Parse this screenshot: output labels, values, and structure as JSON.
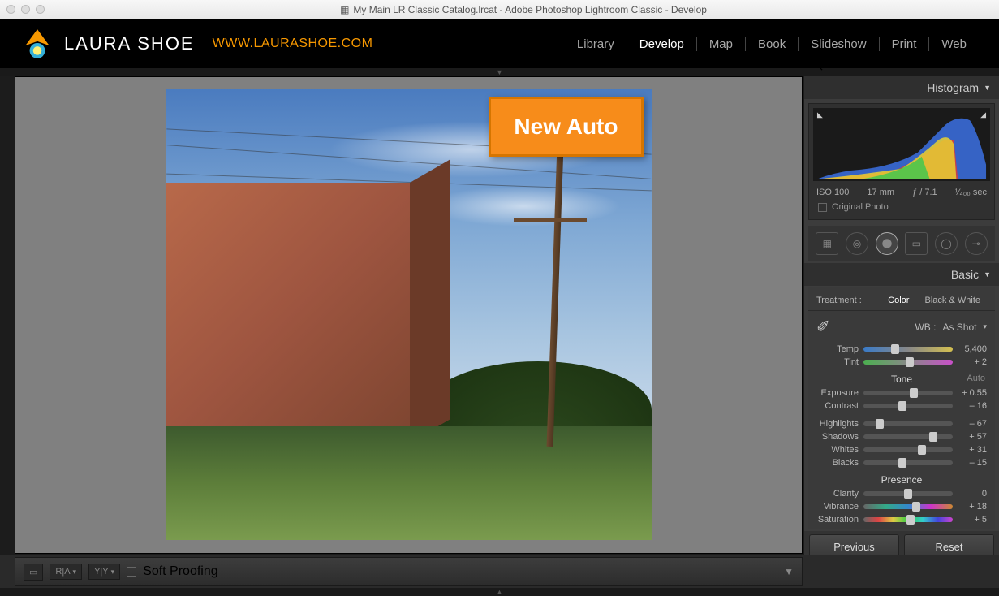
{
  "titlebar": {
    "title": "My Main LR Classic Catalog.lrcat - Adobe Photoshop Lightroom Classic - Develop"
  },
  "branding": {
    "name": "LAURA SHOE",
    "url": "WWW.LAURASHOE.COM"
  },
  "modules": {
    "items": [
      "Library",
      "Develop",
      "Map",
      "Book",
      "Slideshow",
      "Print",
      "Web"
    ],
    "active": "Develop"
  },
  "overlay": {
    "label": "New Auto"
  },
  "histogram": {
    "title": "Histogram",
    "iso": "ISO 100",
    "focal": "17 mm",
    "aperture": "ƒ / 7.1",
    "shutter": "¹⁄₄₀₀ sec",
    "original_label": "Original Photo"
  },
  "basic": {
    "title": "Basic",
    "treatment_label": "Treatment :",
    "treatment_options": [
      "Color",
      "Black & White"
    ],
    "treatment_selected": "Color",
    "wb_label": "WB :",
    "wb_value": "As Shot",
    "tone_title": "Tone",
    "auto_label": "Auto",
    "presence_title": "Presence",
    "sliders": {
      "temp": {
        "label": "Temp",
        "value": "5,400",
        "pos": 35
      },
      "tint": {
        "label": "Tint",
        "value": "+ 2",
        "pos": 52
      },
      "exposure": {
        "label": "Exposure",
        "value": "+ 0.55",
        "pos": 56
      },
      "contrast": {
        "label": "Contrast",
        "value": "– 16",
        "pos": 44
      },
      "highlights": {
        "label": "Highlights",
        "value": "– 67",
        "pos": 18
      },
      "shadows": {
        "label": "Shadows",
        "value": "+ 57",
        "pos": 78
      },
      "whites": {
        "label": "Whites",
        "value": "+ 31",
        "pos": 65
      },
      "blacks": {
        "label": "Blacks",
        "value": "– 15",
        "pos": 44
      },
      "clarity": {
        "label": "Clarity",
        "value": "0",
        "pos": 50
      },
      "vibrance": {
        "label": "Vibrance",
        "value": "+ 18",
        "pos": 59
      },
      "saturation": {
        "label": "Saturation",
        "value": "+ 5",
        "pos": 53
      }
    }
  },
  "footer": {
    "soft_proof": "Soft Proofing",
    "previous": "Previous",
    "reset": "Reset"
  }
}
